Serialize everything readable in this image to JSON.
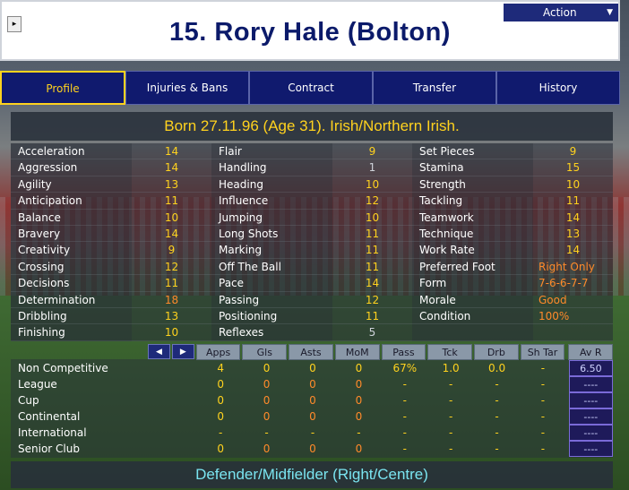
{
  "header": {
    "title": "15. Rory Hale (Bolton)",
    "collapse_icon": "expand-arrow-icon",
    "action_label": "Action"
  },
  "tabs": [
    {
      "label": "Profile",
      "active": true
    },
    {
      "label": "Injuries & Bans",
      "active": false
    },
    {
      "label": "Contract",
      "active": false
    },
    {
      "label": "Transfer",
      "active": false
    },
    {
      "label": "History",
      "active": false
    }
  ],
  "born": "Born 27.11.96 (Age 31). Irish/Northern Irish.",
  "attributes": {
    "col1": [
      {
        "name": "Acceleration",
        "value": "14"
      },
      {
        "name": "Aggression",
        "value": "14"
      },
      {
        "name": "Agility",
        "value": "13"
      },
      {
        "name": "Anticipation",
        "value": "11"
      },
      {
        "name": "Balance",
        "value": "10"
      },
      {
        "name": "Bravery",
        "value": "14"
      },
      {
        "name": "Creativity",
        "value": "9"
      },
      {
        "name": "Crossing",
        "value": "12"
      },
      {
        "name": "Decisions",
        "value": "11"
      },
      {
        "name": "Determination",
        "value": "18"
      },
      {
        "name": "Dribbling",
        "value": "13"
      },
      {
        "name": "Finishing",
        "value": "10"
      }
    ],
    "col2": [
      {
        "name": "Flair",
        "value": "9"
      },
      {
        "name": "Handling",
        "value": "1"
      },
      {
        "name": "Heading",
        "value": "10"
      },
      {
        "name": "Influence",
        "value": "12"
      },
      {
        "name": "Jumping",
        "value": "10"
      },
      {
        "name": "Long Shots",
        "value": "11"
      },
      {
        "name": "Marking",
        "value": "11"
      },
      {
        "name": "Off The Ball",
        "value": "11"
      },
      {
        "name": "Pace",
        "value": "14"
      },
      {
        "name": "Passing",
        "value": "12"
      },
      {
        "name": "Positioning",
        "value": "11"
      },
      {
        "name": "Reflexes",
        "value": "5"
      }
    ],
    "col3": [
      {
        "name": "Set Pieces",
        "value": "9"
      },
      {
        "name": "Stamina",
        "value": "15"
      },
      {
        "name": "Strength",
        "value": "10"
      },
      {
        "name": "Tackling",
        "value": "11"
      },
      {
        "name": "Teamwork",
        "value": "14"
      },
      {
        "name": "Technique",
        "value": "13"
      },
      {
        "name": "Work Rate",
        "value": "14"
      },
      {
        "name": "Preferred Foot",
        "value": "Right Only"
      },
      {
        "name": "Form",
        "value": "7-6-6-7-7"
      },
      {
        "name": "Morale",
        "value": "Good"
      },
      {
        "name": "Condition",
        "value": "100%"
      },
      {
        "name": "",
        "value": ""
      }
    ]
  },
  "stats": {
    "nav_prev_icon": "arrow-left-icon",
    "nav_next_icon": "arrow-right-icon",
    "columns": [
      "Apps",
      "Gls",
      "Asts",
      "MoM",
      "Pass",
      "Tck",
      "Drb",
      "Sh Tar",
      "Av R"
    ],
    "rows": [
      {
        "label": "Non Competitive",
        "values": [
          "4",
          "0",
          "0",
          "0",
          "67%",
          "1.0",
          "0.0",
          "-"
        ],
        "avr": "6.50"
      },
      {
        "label": "League",
        "values": [
          "0",
          "0",
          "0",
          "0",
          "-",
          "-",
          "-",
          "-"
        ],
        "avr": "----"
      },
      {
        "label": "Cup",
        "values": [
          "0",
          "0",
          "0",
          "0",
          "-",
          "-",
          "-",
          "-"
        ],
        "avr": "----"
      },
      {
        "label": "Continental",
        "values": [
          "0",
          "0",
          "0",
          "0",
          "-",
          "-",
          "-",
          "-"
        ],
        "avr": "----"
      },
      {
        "label": "International",
        "values": [
          "-",
          "-",
          "-",
          "-",
          "-",
          "-",
          "-",
          "-"
        ],
        "avr": "----"
      },
      {
        "label": "Senior Club",
        "values": [
          "0",
          "0",
          "0",
          "0",
          "-",
          "-",
          "-",
          "-"
        ],
        "avr": "----"
      }
    ]
  },
  "position": "Defender/Midfielder (Right/Centre)",
  "colors": {
    "accent": "#ffd21e",
    "orange": "#ff8a2a",
    "tab_bg": "#101a6e",
    "title": "#0b1a6a",
    "position": "#7ae4f0"
  }
}
